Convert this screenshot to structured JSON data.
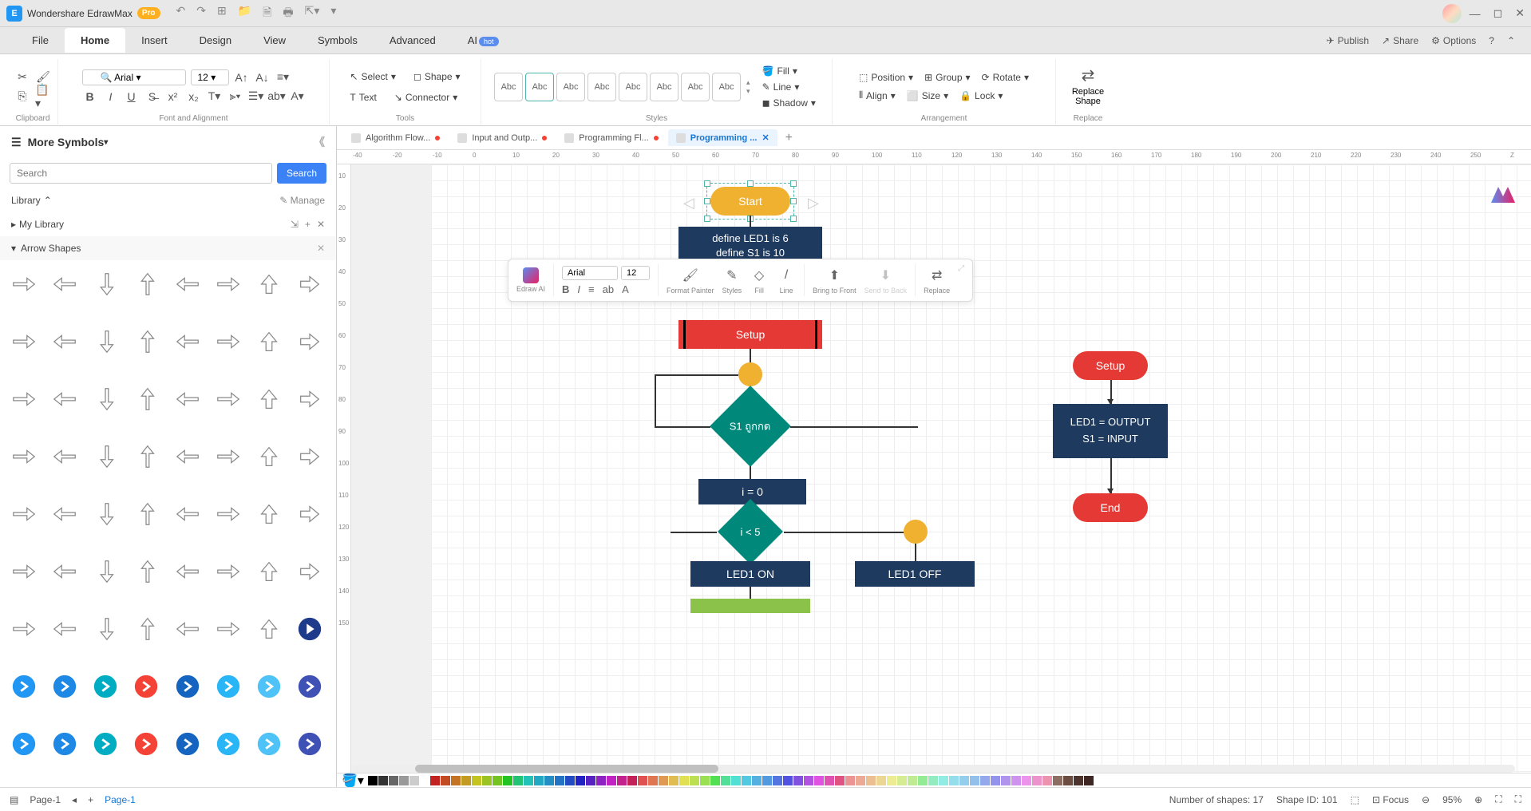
{
  "app": {
    "title": "Wondershare EdrawMax",
    "pro": "Pro"
  },
  "menu": {
    "items": [
      "File",
      "Home",
      "Insert",
      "Design",
      "View",
      "Symbols",
      "Advanced",
      "AI"
    ],
    "active": 1,
    "hot_label": "hot",
    "right": {
      "publish": "Publish",
      "share": "Share",
      "options": "Options"
    }
  },
  "ribbon": {
    "clipboard_label": "Clipboard",
    "font_label": "Font and Alignment",
    "font_name": "Arial",
    "font_size": "12",
    "tools_label": "Tools",
    "select": "Select",
    "text": "Text",
    "shape": "Shape",
    "connector": "Connector",
    "styles_label": "Styles",
    "style_sample": "Abc",
    "fill": "Fill",
    "line": "Line",
    "shadow": "Shadow",
    "arrangement_label": "Arrangement",
    "position": "Position",
    "align": "Align",
    "group": "Group",
    "size": "Size",
    "rotate": "Rotate",
    "lock": "Lock",
    "replace_label": "Replace",
    "replace_shape": "Replace Shape"
  },
  "leftpanel": {
    "title": "More Symbols",
    "search_placeholder": "Search",
    "search_btn": "Search",
    "library": "Library",
    "manage": "Manage",
    "mylibrary": "My Library",
    "category": "Arrow Shapes"
  },
  "tabs": [
    {
      "label": "Algorithm Flow...",
      "dirty": true,
      "active": false
    },
    {
      "label": "Input and Outp...",
      "dirty": true,
      "active": false
    },
    {
      "label": "Programming Fl...",
      "dirty": true,
      "active": false
    },
    {
      "label": "Programming ...",
      "dirty": false,
      "active": true
    }
  ],
  "float_toolbar": {
    "edraw_ai": "Edraw AI",
    "font": "Arial",
    "size": "12",
    "format_painter": "Format Painter",
    "styles": "Styles",
    "fill": "Fill",
    "line": "Line",
    "bring_to_front": "Bring to Front",
    "send_to_back": "Send to Back",
    "replace": "Replace"
  },
  "chart_data": {
    "type": "flowchart",
    "main_flow": [
      {
        "id": "start",
        "shape": "terminator",
        "label": "Start",
        "selected": true
      },
      {
        "id": "define",
        "shape": "process",
        "label": "define LED1 is 6\ndefine S1 is 10"
      },
      {
        "id": "setup",
        "shape": "predefined",
        "label": "Setup"
      },
      {
        "id": "conn1",
        "shape": "connector",
        "label": ""
      },
      {
        "id": "s1",
        "shape": "decision",
        "label": "S1 ถูกกด"
      },
      {
        "id": "i0",
        "shape": "process",
        "label": "i = 0"
      },
      {
        "id": "i5",
        "shape": "decision",
        "label": "i < 5"
      },
      {
        "id": "conn2",
        "shape": "connector",
        "label": ""
      },
      {
        "id": "led_on",
        "shape": "process",
        "label": "LED1 ON"
      },
      {
        "id": "led_off",
        "shape": "process",
        "label": "LED1 OFF"
      }
    ],
    "sub_flow": [
      {
        "id": "setup2",
        "shape": "terminator",
        "label": "Setup"
      },
      {
        "id": "io",
        "shape": "process",
        "label": "LED1 = OUTPUT\nS1 = INPUT"
      },
      {
        "id": "end",
        "shape": "terminator",
        "label": "End"
      }
    ],
    "edges": [
      [
        "start",
        "define"
      ],
      [
        "define",
        "setup"
      ],
      [
        "setup",
        "conn1"
      ],
      [
        "conn1",
        "s1"
      ],
      [
        "s1",
        "i0",
        "true"
      ],
      [
        "s1",
        "conn1",
        "false-loop"
      ],
      [
        "i0",
        "i5"
      ],
      [
        "i5",
        "led_on",
        "true"
      ],
      [
        "i5",
        "conn2",
        "false"
      ],
      [
        "conn2",
        "led_off"
      ],
      [
        "setup2",
        "io"
      ],
      [
        "io",
        "end"
      ]
    ]
  },
  "ruler_h": [
    "-40",
    "-20",
    "-10",
    "0",
    "10",
    "20",
    "30",
    "40",
    "50",
    "60",
    "70",
    "80",
    "90",
    "100",
    "110",
    "120",
    "130",
    "140",
    "150",
    "160",
    "170",
    "180",
    "190",
    "200",
    "210",
    "220",
    "230",
    "240",
    "250",
    "Z"
  ],
  "ruler_v": [
    "10",
    "20",
    "30",
    "40",
    "50",
    "60",
    "70",
    "80",
    "90",
    "100",
    "110",
    "120",
    "130",
    "140",
    "150"
  ],
  "statusbar": {
    "page_current": "Page-1",
    "page_link": "Page-1",
    "num_shapes": "Number of shapes: 17",
    "shape_id": "Shape ID: 101",
    "focus": "Focus",
    "zoom": "95%"
  },
  "colors": [
    "#000000",
    "#444444",
    "#e53935",
    "#d81b60",
    "#8e24aa",
    "#5e35b1",
    "#3949ab",
    "#1e88e5",
    "#039be5",
    "#00acc1",
    "#00897b",
    "#43a047",
    "#7cb342",
    "#c0ca33",
    "#fdd835",
    "#ffb300",
    "#fb8c00",
    "#f4511e",
    "#6d4c41",
    "#757575",
    "#546e7a"
  ]
}
